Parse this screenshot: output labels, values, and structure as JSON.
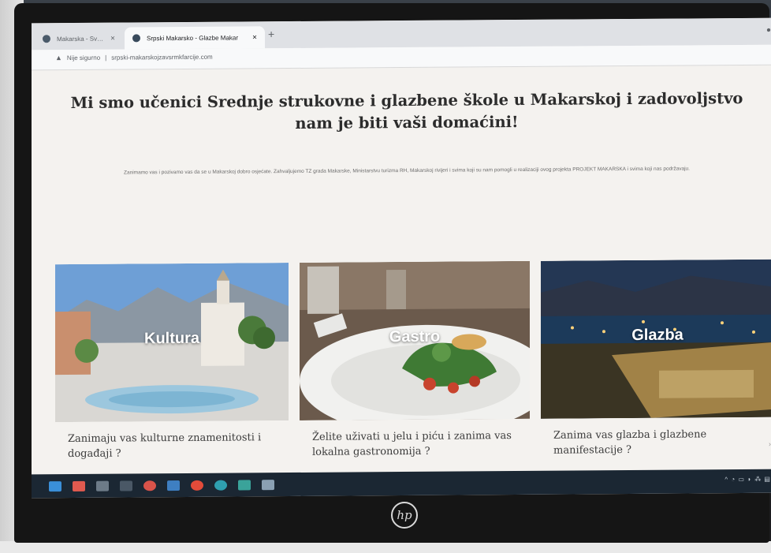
{
  "browser": {
    "tabs": [
      {
        "label": "Makarska - Sve vijesti",
        "active": false
      },
      {
        "label": "Srpski Makarsko - Glazbe Makar",
        "active": true
      }
    ],
    "new_tab_label": "+",
    "close_label": "×",
    "menu_label": "●",
    "address": {
      "security_label": "Nije sigurno",
      "url": "srpski-makarskojzavsrmkfarcije.com"
    }
  },
  "page": {
    "headline": "Mi smo učenici Srednje strukovne i glazbene škole u Makarskoj i zadovoljstvo nam je biti vaši domaćini!",
    "intro": "Zanimamo vas i pozivamo vas da se u Makarskoj dobro osjećate. Zahvaljujemo TZ grada Makarske, Ministarstvu turizma RH, Makarskoj rivijeri i svima koji su nam pomogli u realizaciji ovog projekta PROJEKT MAKARSKA i svima koji nas podržavaju.",
    "cards": [
      {
        "title": "Kultura",
        "caption": "Zanimaju vas kulturne znamenitosti i događaji ?"
      },
      {
        "title": "Gastro",
        "caption": "Želite uživati u jelu i piću i zanima vas lokalna gastronomija ?"
      },
      {
        "title": "Glazba",
        "caption": "Zanima vas glazba i glazbene manifestacije ?"
      }
    ],
    "scroll_arrow": "›"
  },
  "taskbar": {
    "start_label": "◧",
    "tray_text": "^ ◔ ▭ ◗ ⁂ ▤"
  },
  "laptop": {
    "logo_text": "hp"
  },
  "colors": {
    "page_bg": "#f4f2ef",
    "taskbar": "#1b2733",
    "heading": "#2c2c2c"
  }
}
